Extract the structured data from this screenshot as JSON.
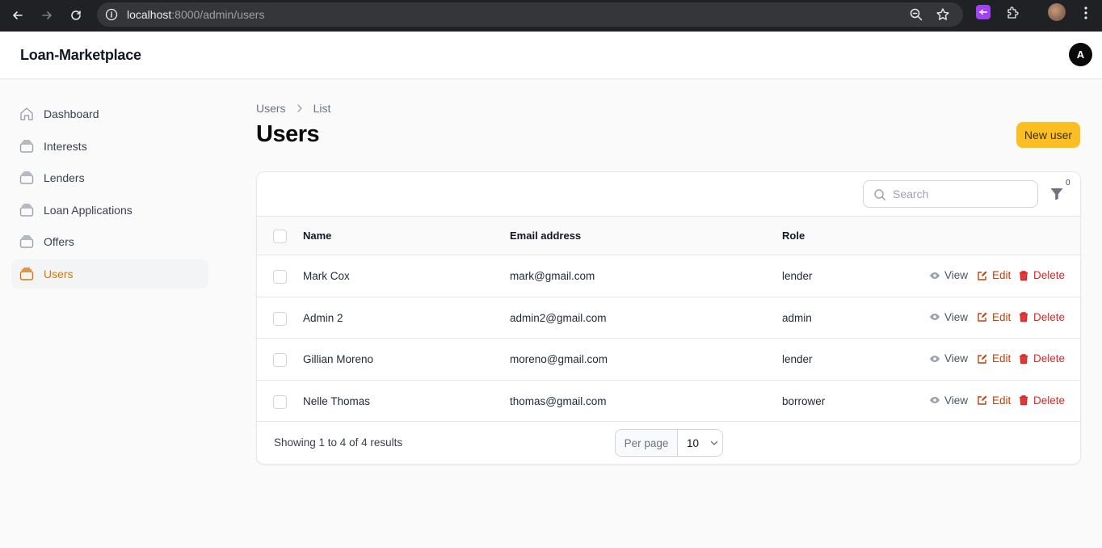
{
  "browser": {
    "url_host": "localhost",
    "url_path": ":8000/admin/users"
  },
  "header": {
    "brand": "Loan-Marketplace",
    "avatar_initial": "A"
  },
  "sidebar": {
    "items": [
      {
        "label": "Dashboard",
        "icon": "home-icon",
        "active": false
      },
      {
        "label": "Interests",
        "icon": "stack-icon",
        "active": false
      },
      {
        "label": "Lenders",
        "icon": "stack-icon",
        "active": false
      },
      {
        "label": "Loan Applications",
        "icon": "stack-icon",
        "active": false
      },
      {
        "label": "Offers",
        "icon": "stack-icon",
        "active": false
      },
      {
        "label": "Users",
        "icon": "stack-icon",
        "active": true
      }
    ]
  },
  "breadcrumb": {
    "root": "Users",
    "current": "List"
  },
  "page": {
    "title": "Users",
    "new_button": "New user"
  },
  "table": {
    "search_placeholder": "Search",
    "filter_count": "0",
    "columns": {
      "name": "Name",
      "email": "Email address",
      "role": "Role"
    },
    "actions": {
      "view": "View",
      "edit": "Edit",
      "delete": "Delete"
    },
    "rows": [
      {
        "name": "Mark Cox",
        "email": "mark@gmail.com",
        "role": "lender"
      },
      {
        "name": "Admin 2",
        "email": "admin2@gmail.com",
        "role": "admin"
      },
      {
        "name": "Gillian Moreno",
        "email": "moreno@gmail.com",
        "role": "lender"
      },
      {
        "name": "Nelle Thomas",
        "email": "thomas@gmail.com",
        "role": "borrower"
      }
    ],
    "showing": "Showing 1 to 4 of 4 results",
    "per_page_label": "Per page",
    "per_page_value": "10"
  },
  "colors": {
    "accent": "#d97706",
    "button": "#fbbf24",
    "delete": "#dc2626",
    "edit": "#c2410c"
  }
}
